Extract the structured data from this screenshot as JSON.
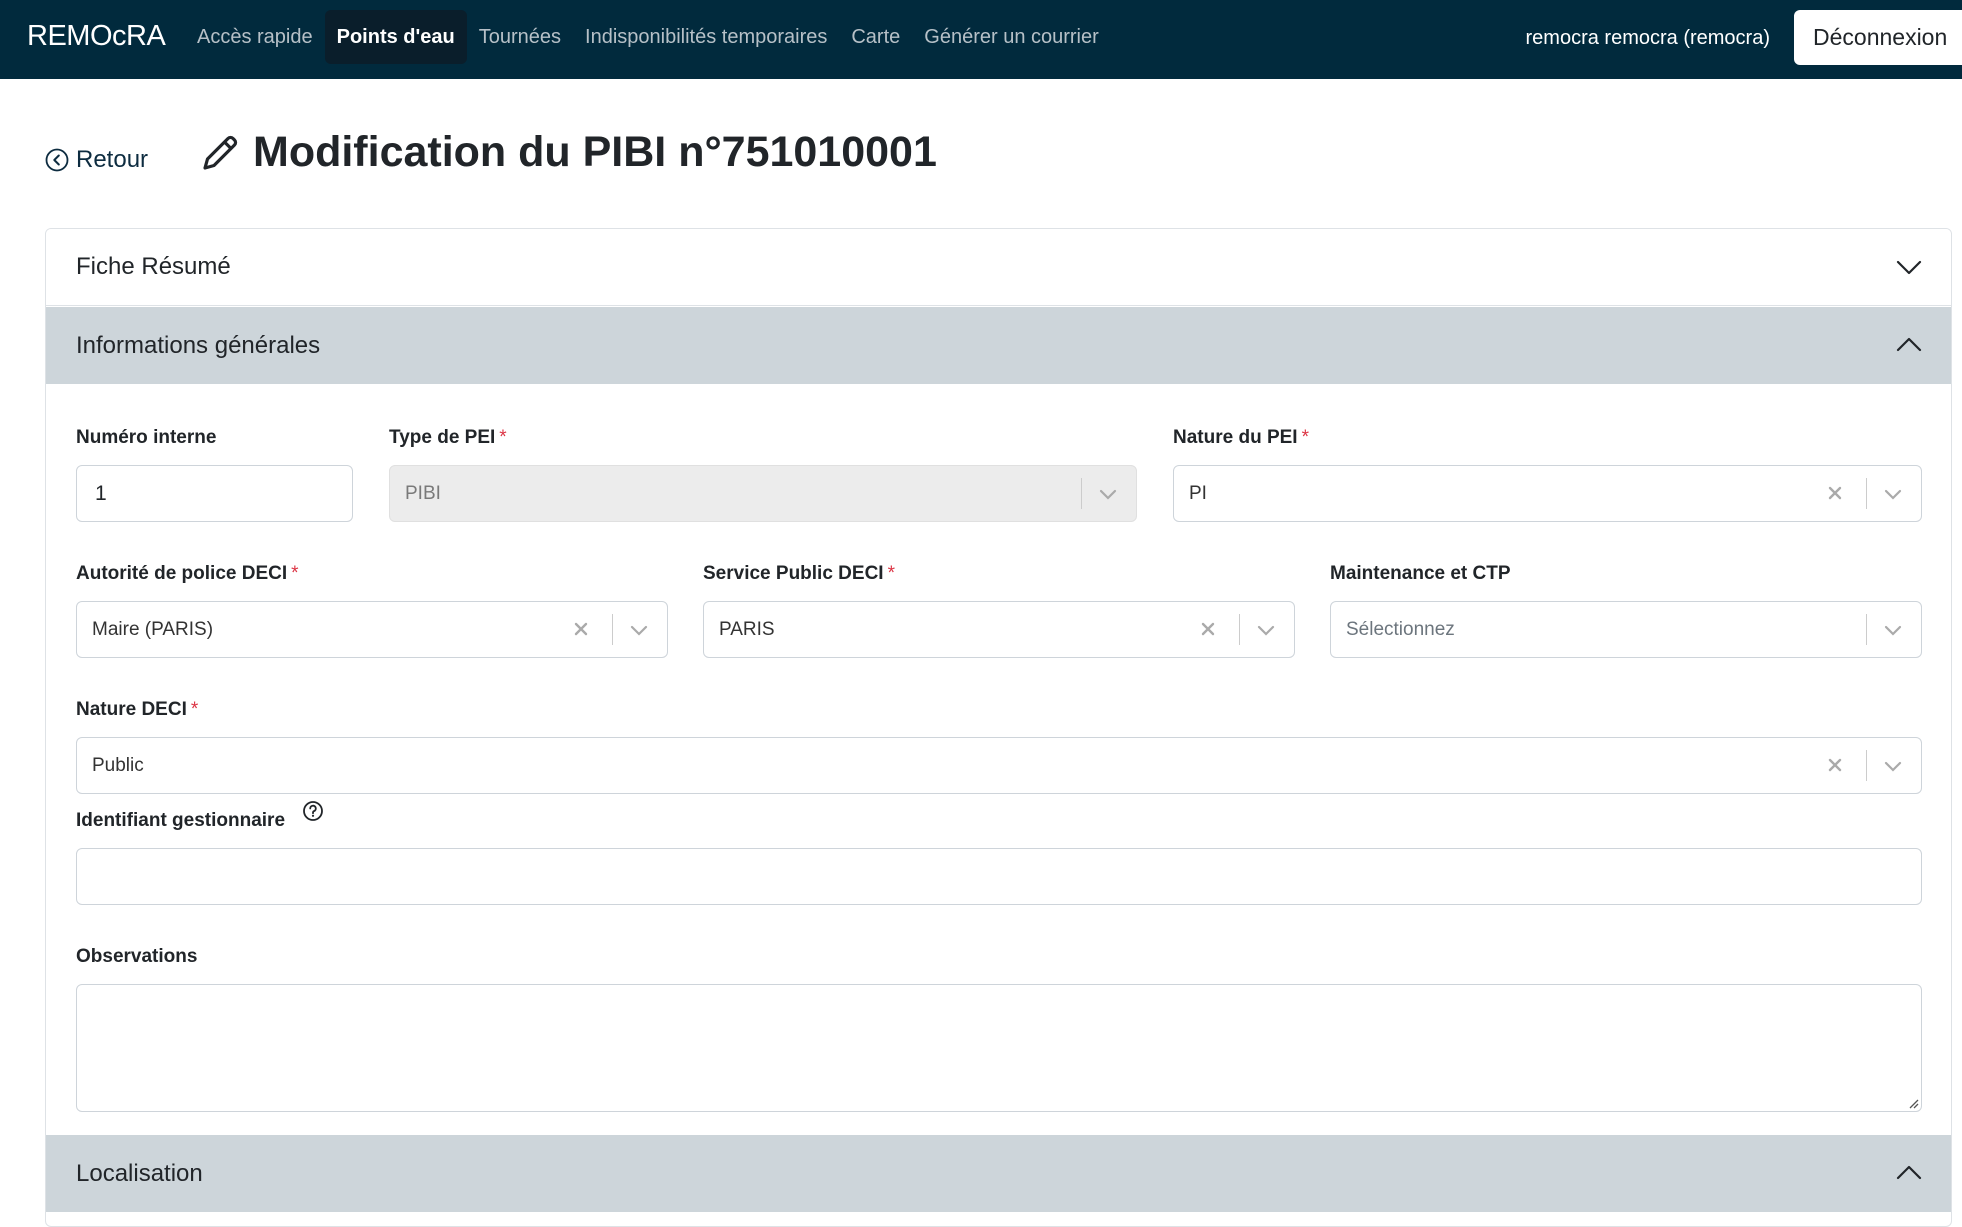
{
  "nav": {
    "brand": "REMOcRA",
    "links": [
      {
        "label": "Accès rapide",
        "active": false
      },
      {
        "label": "Points d'eau",
        "active": true
      },
      {
        "label": "Tournées",
        "active": false
      },
      {
        "label": "Indisponibilités temporaires",
        "active": false
      },
      {
        "label": "Carte",
        "active": false
      },
      {
        "label": "Générer un courrier",
        "active": false
      }
    ],
    "user": "remocra remocra (remocra)",
    "logout_label": "Déconnexion"
  },
  "header": {
    "back_label": "Retour",
    "title": "Modification du PIBI n°751010001"
  },
  "accordion": {
    "fiche_resume": "Fiche Résumé",
    "infos_generales": "Informations générales",
    "localisation": "Localisation"
  },
  "form": {
    "numero_interne": {
      "label": "Numéro interne",
      "value": "1"
    },
    "type_pei": {
      "label": "Type de PEI",
      "required": "*",
      "value": "PIBI"
    },
    "nature_pei": {
      "label": "Nature du PEI",
      "required": "*",
      "value": "PI"
    },
    "autorite_police": {
      "label": "Autorité de police DECI",
      "required": "*",
      "value": "Maire (PARIS)"
    },
    "service_public": {
      "label": "Service Public DECI",
      "required": "*",
      "value": "PARIS"
    },
    "maintenance_ctp": {
      "label": "Maintenance et CTP",
      "placeholder": "Sélectionnez"
    },
    "nature_deci": {
      "label": "Nature DECI",
      "required": "*",
      "value": "Public"
    },
    "identifiant_gestionnaire": {
      "label": "Identifiant gestionnaire",
      "value": ""
    },
    "observations": {
      "label": "Observations",
      "value": ""
    }
  },
  "colors": {
    "navbar": "#012a3d",
    "accordion_open": "#cdd5da",
    "required": "#dc3545"
  }
}
